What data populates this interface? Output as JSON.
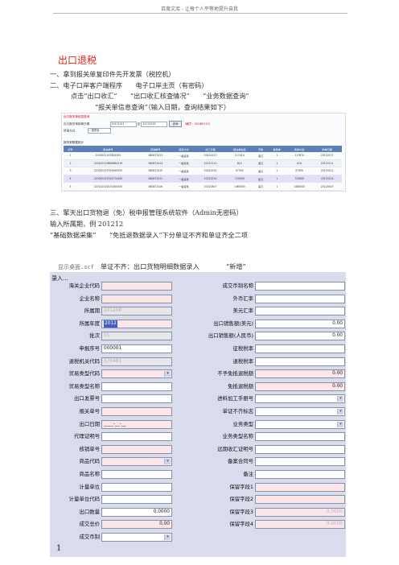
{
  "header": {
    "text": "百度文库 - 让每个人平等地提升自我"
  },
  "title": "出口退税",
  "lines": {
    "l1": "一、拿到报关单复印件先开发票（税控机）",
    "l2": "二、电子口岸客户端程序　　电子口岸主页（有密码）",
    "l3": "点击“出口收汇”　　“出口收汇核查情况”　　“业务数据查询”",
    "l4": "“报关单信息查询”（输入日期，查询结果如下）",
    "l5": "三、擎天出口货物退（免）税申报管理系统软件（Admin无密码）",
    "l6": "输入所属期，例 201212",
    "l7": "“基础数据采集”　　“免抵退数据录入”下分单证不齐和单证齐全二项"
  },
  "shot1": {
    "heading": "出口报关单信息查询",
    "date_label": "出口报关单制单日期",
    "date_from": "20121011",
    "to": "至",
    "date_to": "20121031",
    "query_button": "查询",
    "hint": "（格式：20080101）",
    "trade_label": "贸易方式",
    "trade_value": "一般贸易",
    "grid_title": "报关单数据统计",
    "columns": [
      "序号",
      "报关单号",
      "核销单号",
      "贸易方式",
      "出口日期",
      "报关单金额",
      "币制",
      "数量单",
      "离岸价格",
      "制单日期"
    ],
    "rows": [
      [
        "1",
        "220020119784430S",
        "080872413",
        "一般贸易",
        "20120117",
        "117414",
        "美元",
        "1",
        "117874",
        "20120117"
      ],
      [
        "2",
        "220420120860864219",
        "080872414",
        "一般贸易",
        "20120111",
        "810",
        "美元",
        "1",
        "810",
        "20120111"
      ],
      [
        "3",
        "220020120700440205",
        "080872415",
        "一般贸易",
        "20120210",
        "97000",
        "美元",
        "1",
        "97000",
        "20120211"
      ],
      [
        "4",
        "220020120700774400",
        "080872412",
        "一般贸易",
        "20120214",
        "729000",
        "欧元",
        "1",
        "729000",
        "20120214"
      ],
      [
        "5",
        "220120120210450305",
        "080872416",
        "一般贸易",
        "20120407",
        "1460000",
        "美元",
        "1",
        "1460000",
        "20120407"
      ],
      [
        "6",
        "220120120580300305",
        "080872417",
        "一般贸易",
        "20120413",
        "100000",
        "欧元",
        "1",
        "100000",
        "20120413"
      ]
    ]
  },
  "caption": {
    "fname": "显示桌面.scf",
    "text": "单证不齐：出口货物明细数据录入",
    "new": "“新增”"
  },
  "form": {
    "title": "录入...",
    "left": [
      {
        "label": "海关企业代码",
        "value": "",
        "style": "pink"
      },
      {
        "label": "企业名称",
        "value": "",
        "style": "pink"
      },
      {
        "label": "所属期",
        "value": "201208",
        "style": "gray"
      },
      {
        "label": "所属年度",
        "value": "2012",
        "style": "pink",
        "hl": true
      },
      {
        "label": "批次",
        "value": "01",
        "style": "gray"
      },
      {
        "label": "申报序号",
        "value": "000001",
        "style": "white"
      },
      {
        "label": "退税机关代码",
        "value": "370481",
        "style": "gray"
      },
      {
        "label": "贸易类型代码",
        "value": "",
        "style": "pink",
        "dd": true
      },
      {
        "label": "贸易类型名称",
        "value": "",
        "style": "white"
      },
      {
        "label": "出口发票号",
        "value": "",
        "style": "white"
      },
      {
        "label": "报关单号",
        "value": "",
        "style": "pink"
      },
      {
        "label": "出口日期",
        "value": "____-__-__",
        "style": "pink"
      },
      {
        "label": "代理证明号",
        "value": "",
        "style": "white"
      },
      {
        "label": "核销单号",
        "value": "",
        "style": "pink"
      },
      {
        "label": "商品代码",
        "value": "",
        "style": "pink",
        "dd": true
      },
      {
        "label": "商品名称",
        "value": "",
        "style": "white"
      },
      {
        "label": "计量单位",
        "value": "",
        "style": "white"
      },
      {
        "label": "计量单位代码",
        "value": "",
        "style": "white"
      },
      {
        "label": "出口数量",
        "value": "0.0000",
        "style": "white",
        "num": true
      },
      {
        "label": "成交总价",
        "value": "0.00",
        "style": "pink",
        "num": true
      },
      {
        "label": "成交币制",
        "value": "",
        "style": "white",
        "dd": true
      }
    ],
    "right": [
      {
        "label": "成交币制名称",
        "value": "",
        "style": "white"
      },
      {
        "label": "外币汇率",
        "value": "",
        "style": "white"
      },
      {
        "label": "美元汇率",
        "value": "",
        "style": "white"
      },
      {
        "label": "出口销售额(美元)",
        "value": "0.00",
        "style": "white",
        "num": true
      },
      {
        "label": "出口销售额(人民币)",
        "value": "0.00",
        "style": "white",
        "num": true
      },
      {
        "label": "征税税率",
        "value": "",
        "style": "white"
      },
      {
        "label": "退税税率",
        "value": "",
        "style": "white"
      },
      {
        "label": "不予免抵退税额",
        "value": "0.00",
        "style": "pink",
        "num": true
      },
      {
        "label": "免抵退税额",
        "value": "0.00",
        "style": "pink",
        "num": true
      },
      {
        "label": "进料加工手册号",
        "value": "",
        "style": "white",
        "dd": true
      },
      {
        "label": "单证不齐标志",
        "value": "",
        "style": "white",
        "dd": true
      },
      {
        "label": "业务类型",
        "value": "",
        "style": "white",
        "dd": true
      },
      {
        "label": "业务类型名称",
        "value": "",
        "style": "white"
      },
      {
        "label": "远期收汇证明号",
        "value": "",
        "style": "white"
      },
      {
        "label": "备案合同号",
        "value": "",
        "style": "white"
      },
      {
        "label": "备注",
        "value": "",
        "style": "white"
      },
      {
        "label": "保留字段1",
        "value": "",
        "style": "pink"
      },
      {
        "label": "保留字段2",
        "value": "",
        "style": "pink"
      },
      {
        "label": "保留字段3",
        "value": "0.0000",
        "style": "pink",
        "num": true,
        "ro": true
      },
      {
        "label": "保留字段4",
        "value": "0.0000",
        "style": "pink",
        "num": true,
        "ro": true
      }
    ]
  },
  "page_number": "1"
}
